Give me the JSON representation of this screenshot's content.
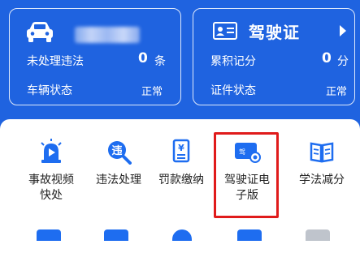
{
  "vehicle_card": {
    "pending_violations_label": "未处理违法",
    "pending_violations_count": "0",
    "pending_violations_unit": "条",
    "vehicle_status_label": "车辆状态",
    "vehicle_status_value": "正常"
  },
  "license_card": {
    "title": "驾驶证",
    "points_label": "累积记分",
    "points_value": "0",
    "points_unit": "分",
    "license_status_label": "证件状态",
    "license_status_value": "正常"
  },
  "services": [
    {
      "label": "事故视频\n快处",
      "icon": "accident-video-siren-icon"
    },
    {
      "label": "违法处理",
      "icon": "violation-search-icon"
    },
    {
      "label": "罚款缴纳",
      "icon": "fine-payment-receipt-icon"
    },
    {
      "label": "驾驶证电\n子版",
      "icon": "e-driver-license-card-icon",
      "card_text": "驾"
    },
    {
      "label": "学法减分",
      "icon": "study-book-icon"
    }
  ],
  "colors": {
    "background_blue": "#1f63e0",
    "icon_blue": "#1e6df0",
    "highlight_red": "#e01b1b"
  }
}
